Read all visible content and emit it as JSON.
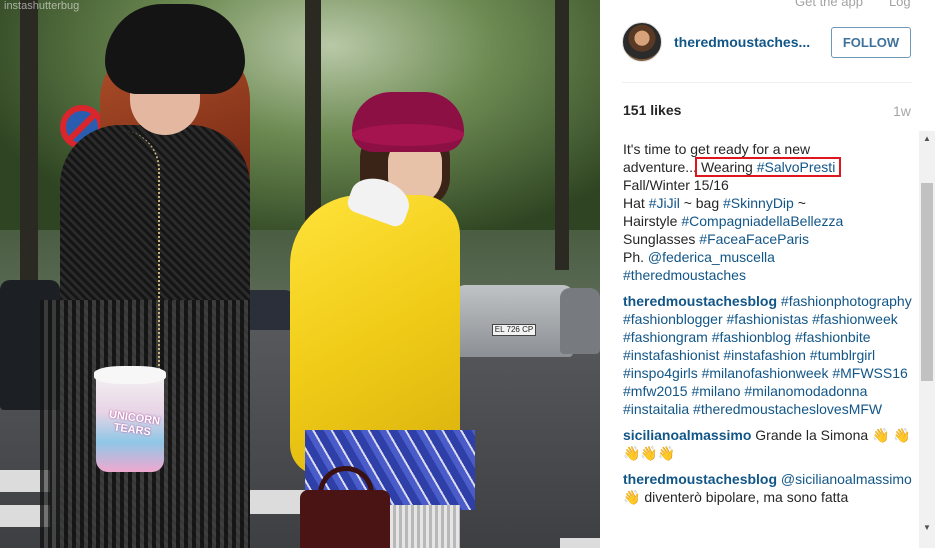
{
  "top_bar": {
    "get_app": "Get the app",
    "login": "Log"
  },
  "post": {
    "username": "theredmoustaches...",
    "follow_label": "FOLLOW",
    "likes": "151 likes",
    "time_ago": "1w"
  },
  "photo": {
    "cup_text": "UNICORN TEARS",
    "plate_text": "EL 726 CP",
    "watermark": "instashutterbug"
  },
  "caption": {
    "line1": "It's time to get ready for a new",
    "line2_pre": "adventure...",
    "highlight_text": "Wearing ",
    "highlight_tag": "#SalvoPresti",
    "line3": "Fall/Winter 15/16",
    "hat_label": "Hat ",
    "hat_tag": "#JiJil",
    "bag_label": " ~ bag ",
    "bag_tag": "#SkinnyDip",
    "bag_suffix": " ~",
    "hair_label": "Hairstyle ",
    "hair_tag": "#CompagniadellaBellezza",
    "sun_label": "Sunglasses ",
    "sun_tag": "#FaceaFaceParis",
    "ph_label": "Ph. ",
    "ph_tag": "@federica_muscella",
    "last_tag": "#theredmoustaches"
  },
  "comments": [
    {
      "user": "theredmoustachesblog",
      "text": "#fashionphotography #fashionblogger #fashionistas #fashionweek #fashiongram #fashionblog #fashionbite #instafashionist #instafashion #tumblrgirl #inspo4girls #milanofashionweek #MFWSS16 #mfw2015 #milano #milanomodadonna #instaitalia #theredmoustacheslovesMFW"
    },
    {
      "user": "sicilianoalmassimo",
      "text": "Grande la Simona 👋 👋👋👋👋"
    },
    {
      "user": "theredmoustachesblog",
      "mention": "@sicilianoalmassimo",
      "text": " 👋 diventerò bipolare, ma sono fatta"
    }
  ],
  "scrollbar": {
    "up_icon": "▲",
    "down_icon": "▼"
  }
}
